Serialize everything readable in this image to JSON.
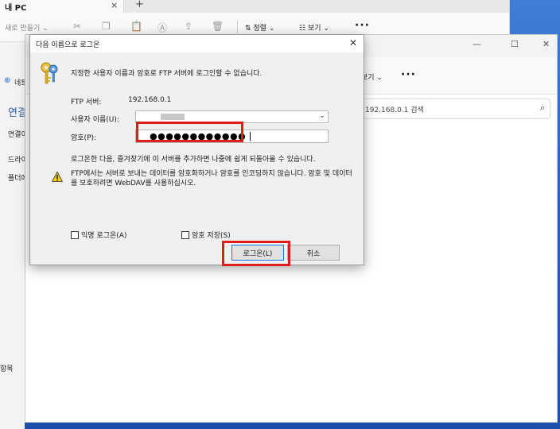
{
  "background_window": {
    "tab_title": "내 PC",
    "tab_close": "×",
    "new_tab": "+",
    "toolbar": {
      "new_label": "새로 만들기 ⌄",
      "sort_label": "정렬 ⌄",
      "view_label": "보기 ⌄",
      "more_label": "···"
    },
    "sidebar": {
      "network_item": "네트워크",
      "section_title": "연결",
      "items": [
        "연결이",
        "드라이브",
        "폴더에"
      ]
    },
    "footer_text": "항목"
  },
  "middle_window": {
    "controls": [
      "—",
      "☐",
      "✕"
    ],
    "view_label": "보기 ⌄",
    "more_label": "···",
    "search_placeholder": "192.168.0.1 검색",
    "search_icon": "⌕"
  },
  "dialog": {
    "title": "다음 이름으로 로그온",
    "close_icon": "✕",
    "message": "지정한 사용자 이름과 암호로 FTP 서버에 로그인할 수 없습니다.",
    "server_label": "FTP 서버:",
    "server_value": "192.168.0.1",
    "username_label": "사용자 이름(U):",
    "password_label": "암호(P):",
    "password_value": "●●●●●●●●●●●●",
    "info_text": "로그온한 다음, 즐겨찾기에 이 서버를 추가하면 나중에 쉽게 되돌아올 수 있습니다.",
    "warning_text": "FTP에서는 서버로 보내는 데이터를 암호화하거나 암호를 인코딩하지 않습니다. 암호 및 데이터를 보호하려면 WebDAV를 사용하십시오.",
    "anonymous_label": "익명 로그온(A)",
    "save_password_label": "암호 저장(S)",
    "login_button": "로그온(L)",
    "cancel_button": "취소"
  },
  "colors": {
    "highlight": "#e21b1b",
    "accent": "#1a73e8",
    "desktop": "#2a63c4"
  }
}
